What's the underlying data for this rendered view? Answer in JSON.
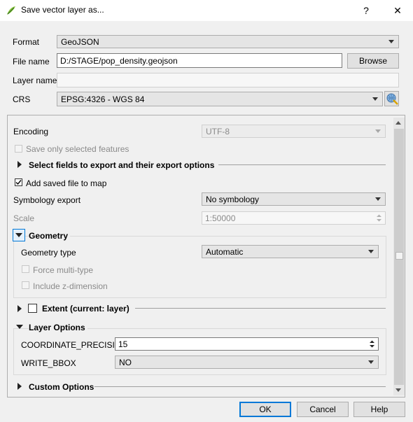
{
  "window": {
    "title": "Save vector layer as...",
    "help_glyph": "?",
    "close_glyph": "✕"
  },
  "top": {
    "format_label": "Format",
    "format_value": "GeoJSON",
    "filename_label": "File name",
    "filename_value": "D:/STAGE/pop_density.geojson",
    "browse_label": "Browse",
    "layername_label": "Layer name",
    "layername_value": "",
    "crs_label": "CRS",
    "crs_value": "EPSG:4326 - WGS 84"
  },
  "panel": {
    "encoding_label": "Encoding",
    "encoding_value": "UTF-8",
    "save_selected_label": "Save only selected features",
    "select_fields_label": "Select fields to export and their export options",
    "add_saved_label": "Add saved file to map",
    "symbology_label": "Symbology export",
    "symbology_value": "No symbology",
    "scale_label": "Scale",
    "scale_value": "1:50000",
    "geometry_label": "Geometry",
    "geometry_type_label": "Geometry type",
    "geometry_type_value": "Automatic",
    "force_multi_label": "Force multi-type",
    "z_dimension_label": "Include z-dimension",
    "extent_label": "Extent (current: layer)",
    "layer_options_label": "Layer Options",
    "coord_precision_label": "COORDINATE_PRECISION",
    "coord_precision_value": "15",
    "write_bbox_label": "WRITE_BBOX",
    "write_bbox_value": "NO",
    "custom_options_label": "Custom Options"
  },
  "buttons": {
    "ok": "OK",
    "cancel": "Cancel",
    "help": "Help"
  }
}
